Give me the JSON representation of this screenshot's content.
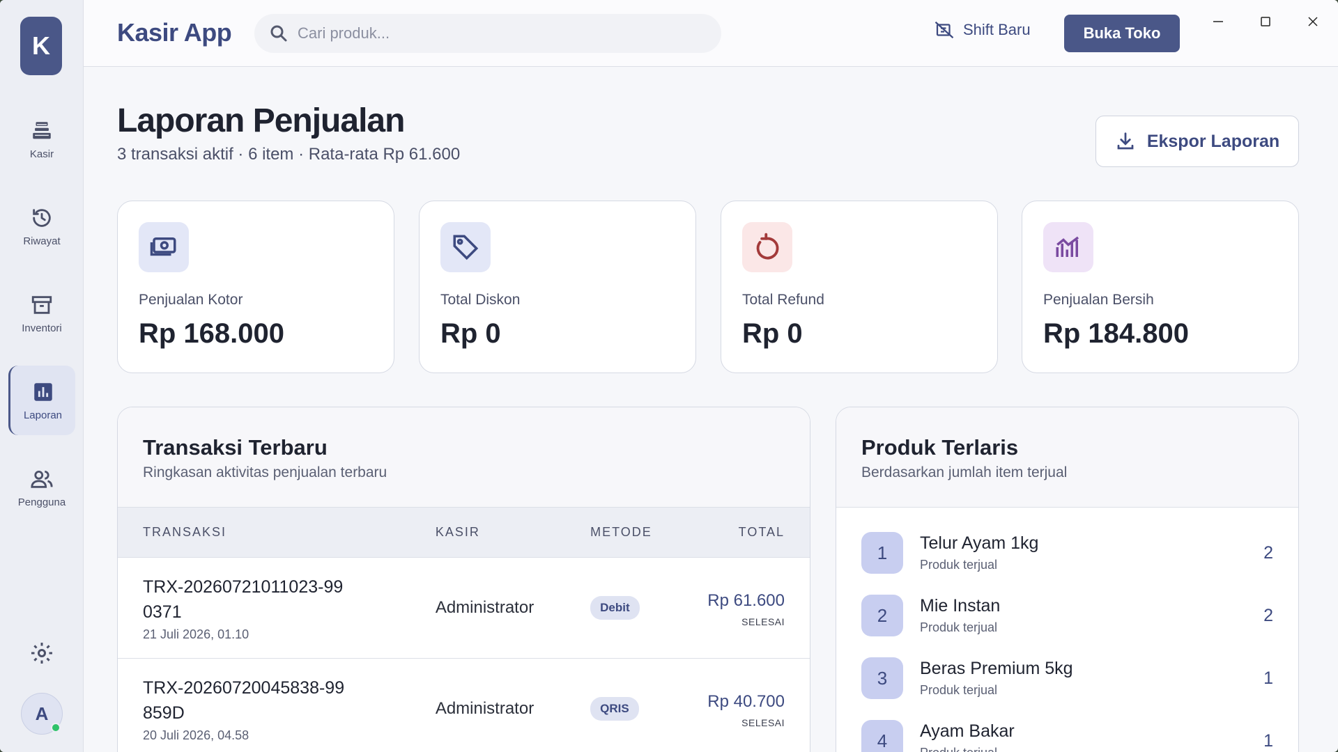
{
  "app": {
    "title": "Kasir App",
    "logo_letter": "K",
    "user_initial": "A"
  },
  "sidebar": {
    "items": [
      {
        "label": "Kasir",
        "icon": "cash-register-icon"
      },
      {
        "label": "Riwayat",
        "icon": "history-icon"
      },
      {
        "label": "Inventori",
        "icon": "archive-box-icon"
      },
      {
        "label": "Laporan",
        "icon": "bar-chart-icon",
        "active": true
      },
      {
        "label": "Pengguna",
        "icon": "users-icon"
      }
    ]
  },
  "header": {
    "search_placeholder": "Cari produk...",
    "shift_label": "Shift Baru",
    "open_store_label": "Buka Toko"
  },
  "page": {
    "title": "Laporan Penjualan",
    "subtitle": "3 transaksi aktif · 6 item · Rata-rata Rp 61.600",
    "export_label": "Ekspor Laporan"
  },
  "stats": [
    {
      "label": "Penjualan Kotor",
      "value": "Rp 168.000",
      "icon": "money-icon",
      "color": "#e3e7f7"
    },
    {
      "label": "Total Diskon",
      "value": "Rp 0",
      "icon": "tag-icon",
      "color": "#e3e7f7"
    },
    {
      "label": "Total Refund",
      "value": "Rp 0",
      "icon": "refund-icon",
      "color": "#fbe7e7"
    },
    {
      "label": "Penjualan Bersih",
      "value": "Rp 184.800",
      "icon": "trend-chart-icon",
      "color": "#efe3f7"
    }
  ],
  "transactions": {
    "title": "Transaksi Terbaru",
    "subtitle": "Ringkasan aktivitas penjualan terbaru",
    "columns": [
      "TRANSAKSI",
      "KASIR",
      "METODE",
      "TOTAL"
    ],
    "rows": [
      {
        "id": "TRX-20260721011023-990371",
        "date": "21 Juli 2026, 01.10",
        "cashier": "Administrator",
        "method": "Debit",
        "amount": "Rp 61.600",
        "status": "SELESAI"
      },
      {
        "id": "TRX-20260720045838-99859D",
        "date": "20 Juli 2026, 04.58",
        "cashier": "Administrator",
        "method": "QRIS",
        "amount": "Rp 40.700",
        "status": "SELESAI"
      }
    ]
  },
  "top_products": {
    "title": "Produk Terlaris",
    "subtitle": "Berdasarkan jumlah item terjual",
    "items": [
      {
        "rank": "1",
        "name": "Telur Ayam 1kg",
        "sub": "Produk terjual",
        "count": "2"
      },
      {
        "rank": "2",
        "name": "Mie Instan",
        "sub": "Produk terjual",
        "count": "2"
      },
      {
        "rank": "3",
        "name": "Beras Premium 5kg",
        "sub": "Produk terjual",
        "count": "1"
      },
      {
        "rank": "4",
        "name": "Ayam Bakar",
        "sub": "Produk terjual",
        "count": "1"
      }
    ]
  }
}
